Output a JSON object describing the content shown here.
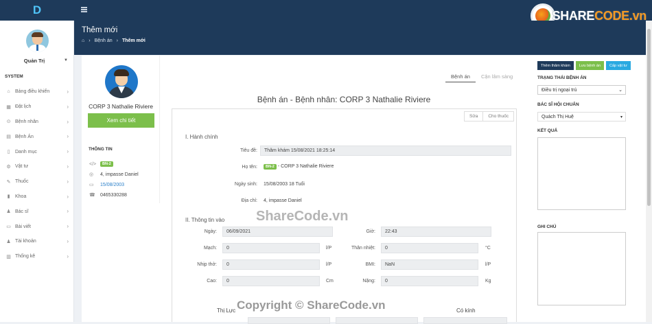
{
  "app": {
    "logo": "D",
    "brand_a": "SHARE",
    "brand_b": "CODE.vn"
  },
  "user": {
    "name": "Quản Trị"
  },
  "sidebar": {
    "section": "SYSTEM",
    "items": [
      {
        "icon": "⌂",
        "label": "Bảng điều khiển"
      },
      {
        "icon": "▦",
        "label": "Đặt lịch"
      },
      {
        "icon": "⊙",
        "label": "Bệnh nhân"
      },
      {
        "icon": "▤",
        "label": "Bệnh Án"
      },
      {
        "icon": "▯",
        "label": "Danh mục"
      },
      {
        "icon": "⚙",
        "label": "Vật tư"
      },
      {
        "icon": "✎",
        "label": "Thuốc"
      },
      {
        "icon": "▮",
        "label": "Khoa"
      },
      {
        "icon": "♟",
        "label": "Bác sĩ"
      },
      {
        "icon": "▭",
        "label": "Bài viết"
      },
      {
        "icon": "♟",
        "label": "Tài khoản"
      },
      {
        "icon": "▥",
        "label": "Thống kê"
      }
    ]
  },
  "header": {
    "title": "Thêm mới",
    "breadcrumb": [
      "Bệnh án",
      "Thêm mới"
    ]
  },
  "patient": {
    "name": "CORP 3 Nathalie Riviere",
    "detail_button": "Xem chi tiết",
    "info_label": "THÔNG TIN",
    "code": "BN-2",
    "address": "4, impasse Daniel",
    "dob": "15/08/2003",
    "phone": "0465330288"
  },
  "tabs": [
    "Bệnh án",
    "Cận lâm sàng"
  ],
  "record": {
    "title": "Bệnh án - Bệnh nhân: CORP 3 Nathalie Riviere",
    "actions": [
      "Sửa",
      "Cho thuốc"
    ],
    "section1": "I. Hành chính",
    "tieude_label": "Tiêu đề:",
    "tieude_value": "Thăm khám 15/08/2021 18:25:14",
    "hoten_label": "Họ tên:",
    "hoten_badge": "BN-2",
    "hoten_value": "- CORP 3 Nathalie Riviere",
    "ngaysinh_label": "Ngày sinh:",
    "ngaysinh_value": "15/08/2003 18 Tuổi",
    "diachi_label": "Địa chỉ:",
    "diachi_value": "4, impasse Daniel",
    "section2": "II. Thông tin vào",
    "ngay_label": "Ngày:",
    "ngay_value": "06/09/2021",
    "gio_label": "Giờ:",
    "gio_value": "22:43",
    "mach_label": "Mạch:",
    "mach_value": "0",
    "mach_unit": "l/P",
    "nhiet_label": "Thân nhiệt:",
    "nhiet_value": "0",
    "nhiet_unit": "°C",
    "nhiptho_label": "Nhịp thở:",
    "nhiptho_value": "0",
    "nhiptho_unit": "l/P",
    "bmi_label": "BMI:",
    "bmi_value": "NaN",
    "bmi_unit": "l/P",
    "cao_label": "Cao:",
    "cao_value": "0",
    "cao_unit": "Cm",
    "nang_label": "Nặng:",
    "nang_value": "0",
    "nang_unit": "Kg",
    "thiluc_label": "Thị Lực",
    "cokinh_label": "Có kính"
  },
  "right": {
    "buttons": [
      {
        "label": "Thêm thăm khám",
        "color": "#1e3a5a"
      },
      {
        "label": "Lưu bệnh án",
        "color": "#7cbf4b"
      },
      {
        "label": "Cấp vật tư",
        "color": "#29a9e1"
      }
    ],
    "status_label": "TRẠNG THÁI BỆNH ÁN",
    "status_value": "Điều trị ngoại trú",
    "doctor_label": "BÁC SĨ HỘI CHUẨN",
    "doctor_value": "Quách Thị Huệ",
    "result_label": "KẾT QUẢ",
    "note_label": "GHI CHÚ"
  },
  "watermarks": {
    "center": "ShareCode.vn",
    "bottom": "Copyright © ShareCode.vn"
  }
}
